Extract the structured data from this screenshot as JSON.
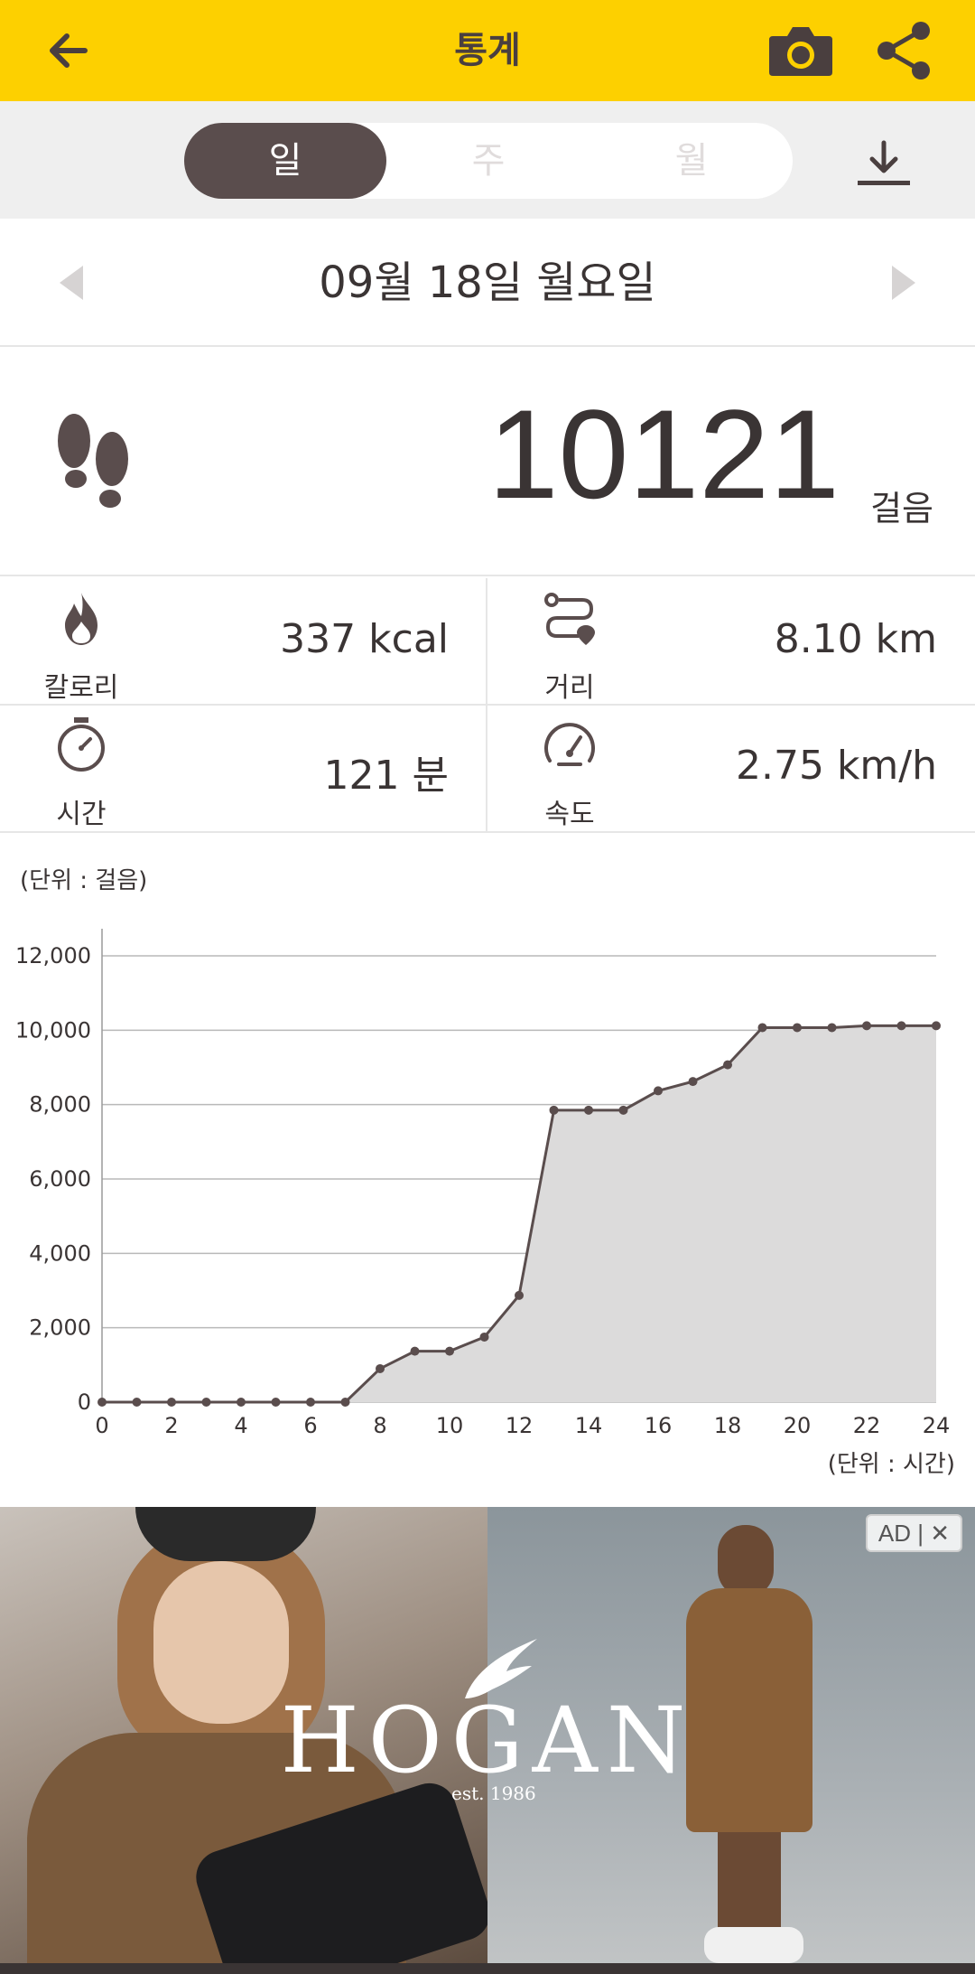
{
  "header": {
    "title": "통계"
  },
  "period_tabs": [
    {
      "label": "일",
      "active": true
    },
    {
      "label": "주",
      "active": false
    },
    {
      "label": "월",
      "active": false
    }
  ],
  "date": {
    "label": "09월 18일 월요일"
  },
  "steps": {
    "count": "10121",
    "unit": "걸음"
  },
  "stats": {
    "calories": {
      "label": "칼로리",
      "value": "337 kcal",
      "icon": "flame-icon"
    },
    "distance": {
      "label": "거리",
      "value": "8.10 km",
      "icon": "route-icon"
    },
    "time": {
      "label": "시간",
      "value": "121 분",
      "icon": "stopwatch-icon"
    },
    "speed": {
      "label": "속도",
      "value": "2.75 km/h",
      "icon": "speedometer-icon"
    }
  },
  "colors": {
    "accent": "#fdd000",
    "dark": "#5a4d4d",
    "fill": "#dcdbdb",
    "line": "#5a4d4d"
  },
  "chart_data": {
    "type": "area",
    "y_unit_label": "(단위 : 걸음)",
    "x_unit_label": "(단위 : 시간)",
    "x": [
      0,
      1,
      2,
      3,
      4,
      5,
      6,
      7,
      8,
      9,
      10,
      11,
      12,
      13,
      14,
      15,
      16,
      17,
      18,
      19,
      20,
      21,
      22,
      23,
      24
    ],
    "values": [
      0,
      0,
      0,
      0,
      0,
      0,
      0,
      0,
      900,
      1370,
      1370,
      1750,
      2870,
      7850,
      7850,
      7850,
      8370,
      8620,
      9070,
      10070,
      10070,
      10070,
      10121,
      10121,
      10121
    ],
    "x_ticks": [
      "0",
      "2",
      "4",
      "6",
      "8",
      "10",
      "12",
      "14",
      "16",
      "18",
      "20",
      "22",
      "24"
    ],
    "y_ticks": [
      "0",
      "2,000",
      "4,000",
      "6,000",
      "8,000",
      "10,000",
      "12,000"
    ],
    "xlim": [
      0,
      24
    ],
    "ylim": [
      0,
      12000
    ],
    "grid": true
  },
  "ad": {
    "badge": "AD | ✕",
    "brand": "HOGAN",
    "est": "est. 1986"
  }
}
